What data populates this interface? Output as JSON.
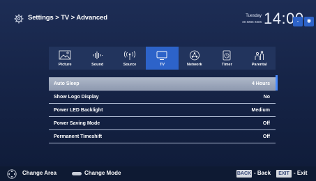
{
  "header": {
    "breadcrumb": "Settings > TV > Advanced",
    "day": "Tuesday",
    "date": "xx xxxx xxxx",
    "time": "14:00",
    "buttons": [
      "minus-icon",
      "star-icon"
    ]
  },
  "tabs": [
    {
      "label": "Picture",
      "icon": "picture-icon",
      "active": false
    },
    {
      "label": "Sound",
      "icon": "sound-icon",
      "active": false
    },
    {
      "label": "Source",
      "icon": "source-icon",
      "active": false
    },
    {
      "label": "TV",
      "icon": "tv-icon",
      "active": true
    },
    {
      "label": "Network",
      "icon": "network-icon",
      "active": false
    },
    {
      "label": "Timer",
      "icon": "timer-icon",
      "active": false
    },
    {
      "label": "Parental",
      "icon": "parental-icon",
      "active": false
    }
  ],
  "menu": [
    {
      "label": "Auto Sleep",
      "value": "4 Hours",
      "selected": true
    },
    {
      "label": "Show Logo Display",
      "value": "No",
      "selected": false
    },
    {
      "label": "Power LED Backlight",
      "value": "Medium",
      "selected": false
    },
    {
      "label": "Power Saving Mode",
      "value": "Off",
      "selected": false
    },
    {
      "label": "Permanent Timeshift",
      "value": "Off",
      "selected": false
    }
  ],
  "footer": {
    "change_area": "Change Area",
    "change_mode": "Change Mode",
    "back_key": "BACK",
    "back_label": "Back",
    "exit_key": "EXIT",
    "exit_label": "Exit"
  },
  "colors": {
    "background": "#162447",
    "active_tab": "#2d63c9",
    "selected_row": "#9aa5ba"
  }
}
